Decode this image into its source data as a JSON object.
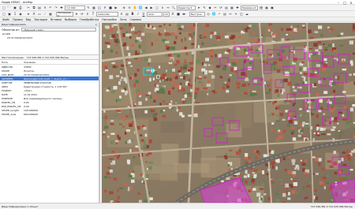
{
  "window": {
    "title": "Надир НУВОС - ArcMap",
    "min_icon": "minimize-icon",
    "max_icon": "maximize-icon",
    "close_icon": "close-icon"
  },
  "toolbar": {
    "scale": "1:2 000",
    "editor_label": "Редактор ▾",
    "georef_label": "Привязка ▾",
    "layer_select": "Carbonite",
    "draw_label": "Рисование ▾",
    "font_select": "Arial",
    "font_size": "10",
    "other_label": "Быстрое"
  },
  "menu": {
    "items": [
      "Файл",
      "Правка",
      "Вид",
      "Закладки",
      "Вставка",
      "Выборка",
      "Геообработка",
      "Настройка",
      "Окна",
      "Справка"
    ]
  },
  "identify": {
    "panel_title": "Идентифицировать",
    "from_label": "Объектов из:",
    "from_value": "<Верхний слой>",
    "tree_layer": "GKR",
    "tree_feature": "23:37:0102019:XXXX",
    "location_label": "Местоположение:",
    "location_value": "713 546,381  4 712 935,364 Метры",
    "columns": [
      "Поле",
      "Значение"
    ],
    "rows": [
      {
        "field": "OBJECTID",
        "value": "33830"
      },
      {
        "field": "SHAPE",
        "value": "Полигон"
      },
      {
        "field": "CAD_NUM",
        "value": "23:37:0102019:XXXX"
      },
      {
        "field": "ADDRESS",
        "value": "Краснодарский край, г. Анапа, ул. ..."
      },
      {
        "field": "SUBTYPE",
        "value": "ЗЕМЕЛЬНЫЙ УЧАСТОК"
      },
      {
        "field": "AREA",
        "value": "Кадастровая стоимость: 1 234 567"
      },
      {
        "field": "FWDKEY",
        "value": "<Null>"
      },
      {
        "field": "DATE",
        "value": "11.01.2021"
      },
      {
        "field": "PURPOSE",
        "value": "Для индивидуального жилищ..."
      },
      {
        "field": "PARCEL_CN",
        "value": "0,00"
      },
      {
        "field": "PAR_PARCEL_CN",
        "value": "0,00"
      },
      {
        "field": "SHAPE_Length",
        "value": "100,000000"
      },
      {
        "field": "SHAPE_Area",
        "value": "600,000000"
      }
    ],
    "selected_row": 3
  },
  "status": {
    "text": "Идентифицировано 1 объект",
    "coords": "713 546,381  4 712 935,364 Метры"
  },
  "colors": {
    "parcel_outline": "#d816d8",
    "parcel_fill": "#e040e0",
    "selection": "#00e5ff",
    "highlight_row": "#3a78d6"
  }
}
